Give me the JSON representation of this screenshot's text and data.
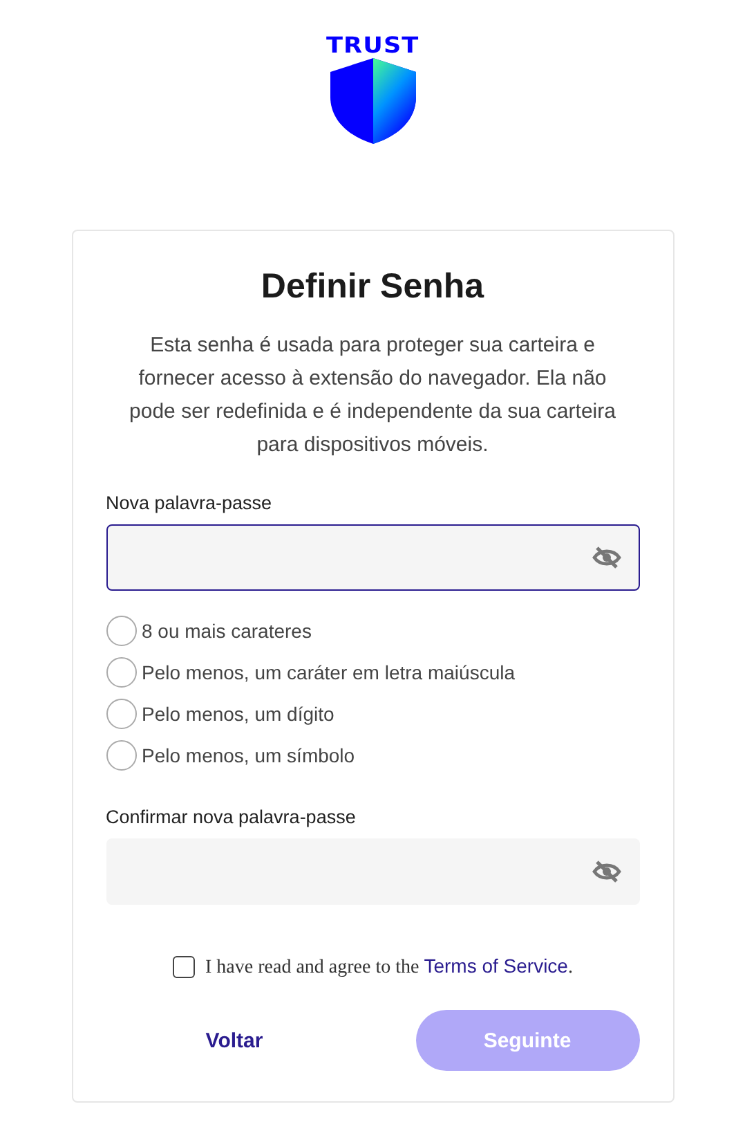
{
  "logo": {
    "text": "TRUST"
  },
  "title": "Definir Senha",
  "description": "Esta senha é usada para proteger sua carteira e fornecer acesso à extensão do navegador. Ela não pode ser redefinida e é independente da sua carteira para dispositivos móveis.",
  "password_field": {
    "label": "Nova palavra-passe",
    "focused": true
  },
  "requirements": [
    {
      "label": "8 ou mais carateres",
      "checked": false
    },
    {
      "label": "Pelo menos, um caráter em letra maiúscula",
      "checked": false
    },
    {
      "label": "Pelo menos, um dígito",
      "checked": false
    },
    {
      "label": "Pelo menos, um símbolo",
      "checked": false
    }
  ],
  "confirm_field": {
    "label": "Confirmar nova palavra-passe",
    "focused": false
  },
  "agreement": {
    "text": "I have read and agree to the ",
    "link": "Terms of Service",
    "suffix": ".",
    "checked": false
  },
  "buttons": {
    "back": "Voltar",
    "next": "Seguinte",
    "next_disabled": true
  }
}
